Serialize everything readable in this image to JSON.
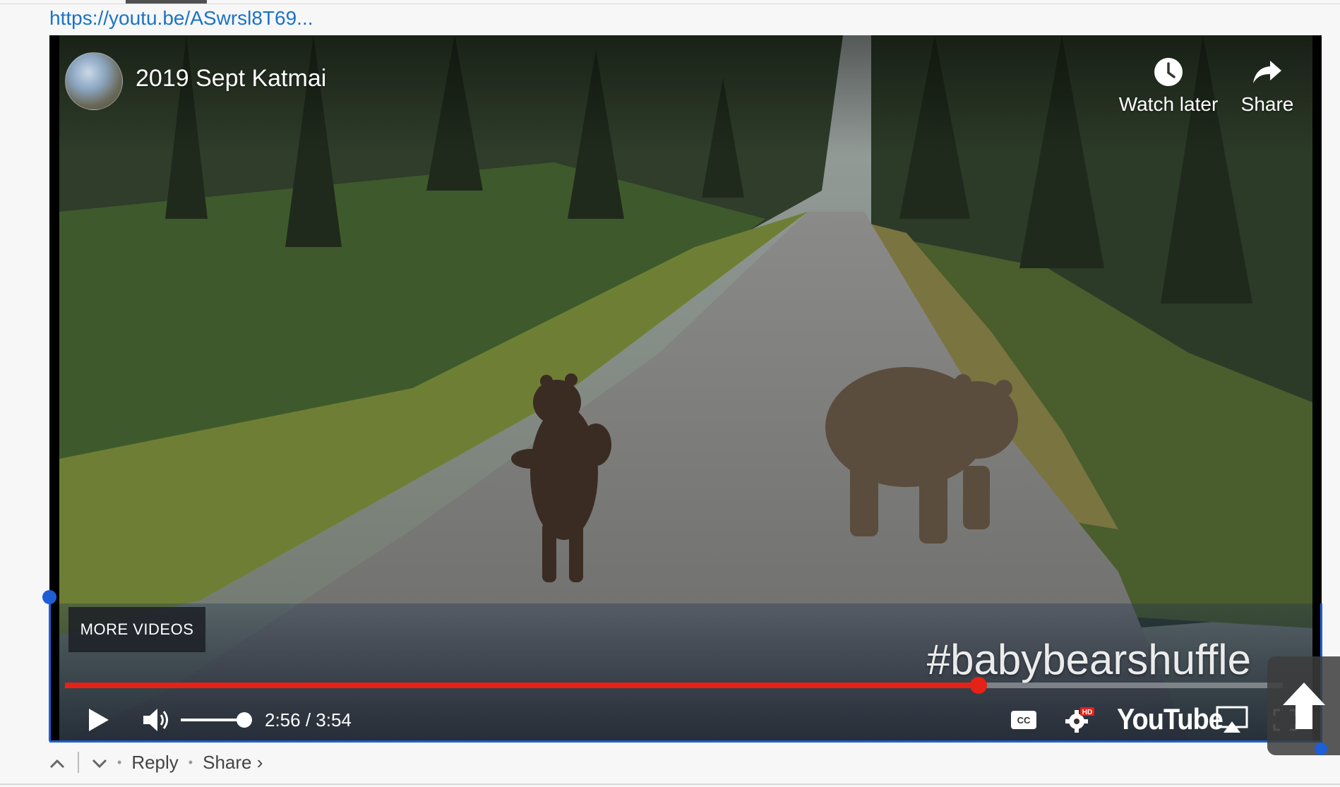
{
  "link": {
    "text": "https://youtu.be/ASwrsl8T69..."
  },
  "video": {
    "title": "2019 Sept Katmai",
    "hashtag": "#babybearshuffle",
    "more_videos": "MORE VIDEOS",
    "watch_later": "Watch later",
    "share": "Share",
    "time_display": "2:56 / 3:54",
    "progress_fraction": 0.75,
    "volume_fraction": 0.8,
    "logo_text": "YouTube",
    "hd_badge": "HD"
  },
  "comment_actions": {
    "reply": "Reply",
    "share": "Share ›"
  },
  "colors": {
    "link": "#1a73c9",
    "progress": "#e62117",
    "selection": "#1f5fd6"
  }
}
